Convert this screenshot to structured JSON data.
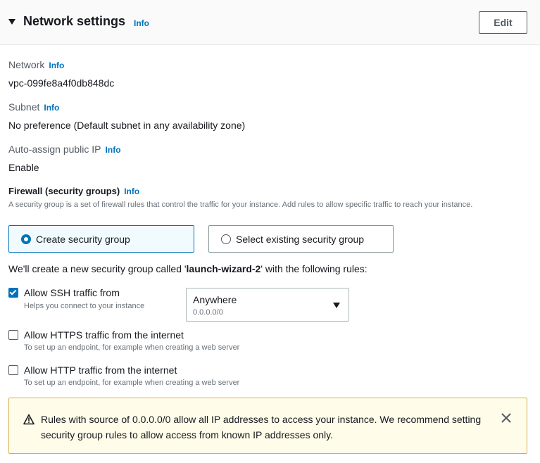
{
  "header": {
    "title": "Network settings",
    "info": "Info",
    "edit_label": "Edit"
  },
  "network": {
    "label": "Network",
    "info": "Info",
    "value": "vpc-099fe8a4f0db848dc"
  },
  "subnet": {
    "label": "Subnet",
    "info": "Info",
    "value": "No preference (Default subnet in any availability zone)"
  },
  "public_ip": {
    "label": "Auto-assign public IP",
    "info": "Info",
    "value": "Enable"
  },
  "firewall": {
    "title": "Firewall (security groups)",
    "info": "Info",
    "description": "A security group is a set of firewall rules that control the traffic for your instance. Add rules to allow specific traffic to reach your instance.",
    "options": [
      {
        "label": "Create security group",
        "selected": true
      },
      {
        "label": "Select existing security group",
        "selected": false
      }
    ]
  },
  "new_sg": {
    "prefix": "We'll create a new security group called '",
    "name": "launch-wizard-2",
    "suffix": "' with the following rules:"
  },
  "rules": [
    {
      "label": "Allow SSH traffic from",
      "description": "Helps you connect to your instance",
      "checked": true
    },
    {
      "label": "Allow HTTPS traffic from the internet",
      "description": "To set up an endpoint, for example when creating a web server",
      "checked": false
    },
    {
      "label": "Allow HTTP traffic from the internet",
      "description": "To set up an endpoint, for example when creating a web server",
      "checked": false
    }
  ],
  "ssh_source": {
    "value": "Anywhere",
    "sub": "0.0.0.0/0"
  },
  "warning": {
    "text": "Rules with source of 0.0.0.0/0 allow all IP addresses to access your instance. We recommend setting security group rules to allow access from known IP addresses only.",
    "icon": "warning-icon",
    "close_icon": "close-icon"
  },
  "colors": {
    "accent": "#0073bb",
    "warning_bg": "#fffce9",
    "warning_border": "#d5b04a"
  }
}
